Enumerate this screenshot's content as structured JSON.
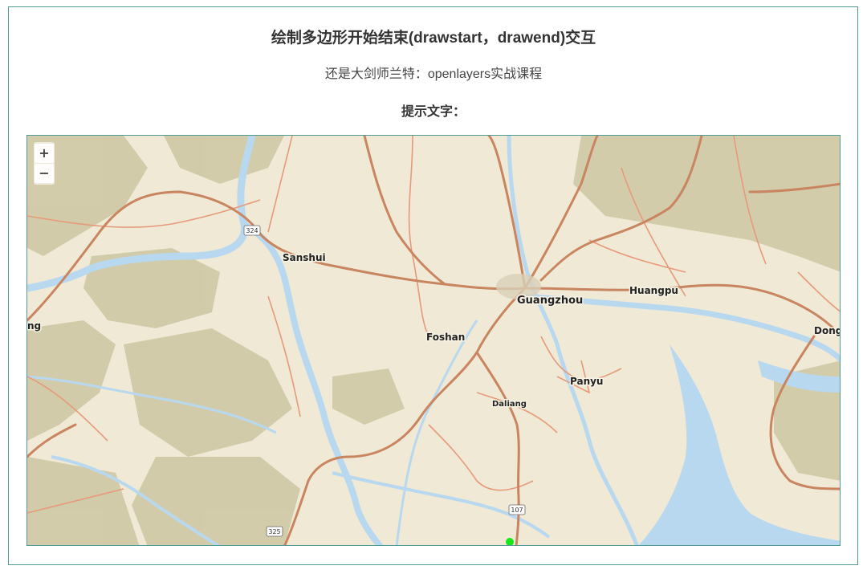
{
  "page": {
    "title": "绘制多边形开始结束(drawstart，drawend)交互",
    "subtitle": "还是大剑师兰特：openlayers实战课程",
    "hint_label": "提示文字：",
    "hint_value": ""
  },
  "map": {
    "zoom_in_label": "+",
    "zoom_out_label": "−",
    "places": {
      "sanshui": "Sanshui",
      "guangzhou": "Guangzhou",
      "huangpu": "Huangpu",
      "foshan": "Foshan",
      "panyu": "Panyu",
      "daliang": "Daliang",
      "dong": "Dong",
      "ng": "ng"
    },
    "shields": {
      "s324": "324",
      "s107": "107",
      "s325": "325"
    },
    "colors": {
      "land": "#efe9d6",
      "water": "#b8d8f0",
      "major_road": "#c98560",
      "minor_road": "#e69a79",
      "terrain": "#b7b08a",
      "draw_point": "#19e619"
    }
  }
}
